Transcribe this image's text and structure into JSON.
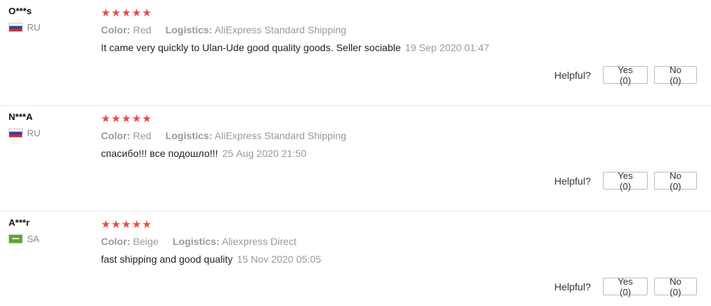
{
  "reviews": [
    {
      "user": "O***s",
      "country": "RU",
      "rating": 5,
      "stars": "★★★★★",
      "color_label": "Color:",
      "color_value": "Red",
      "logistics_label": "Logistics:",
      "logistics_value": "AliExpress Standard Shipping",
      "text": "It came very quickly to Ulan-Ude good quality goods. Seller sociable",
      "date": "19 Sep 2020 01:47",
      "helpful_label": "Helpful?",
      "yes_label": "Yes (0)",
      "no_label": "No (0)",
      "flag_icon": "russia-flag-icon"
    },
    {
      "user": "N***A",
      "country": "RU",
      "rating": 5,
      "stars": "★★★★★",
      "color_label": "Color:",
      "color_value": "Red",
      "logistics_label": "Logistics:",
      "logistics_value": "AliExpress Standard Shipping",
      "text": "спасибо!!! все подошло!!!",
      "date": "25 Aug 2020 21:50",
      "helpful_label": "Helpful?",
      "yes_label": "Yes (0)",
      "no_label": "No (0)",
      "flag_icon": "russia-flag-icon"
    },
    {
      "user": "A***r",
      "country": "SA",
      "rating": 5,
      "stars": "★★★★★",
      "color_label": "Color:",
      "color_value": "Beige",
      "logistics_label": "Logistics:",
      "logistics_value": "Aliexpress Direct",
      "text": "fast shipping and good quality",
      "date": "15 Nov 2020 05:05",
      "helpful_label": "Helpful?",
      "yes_label": "Yes (0)",
      "no_label": "No (0)",
      "flag_icon": "saudi-arabia-flag-icon"
    }
  ],
  "colors": {
    "star": "#f0483e",
    "muted": "#999999",
    "border": "#e8e8e8"
  }
}
